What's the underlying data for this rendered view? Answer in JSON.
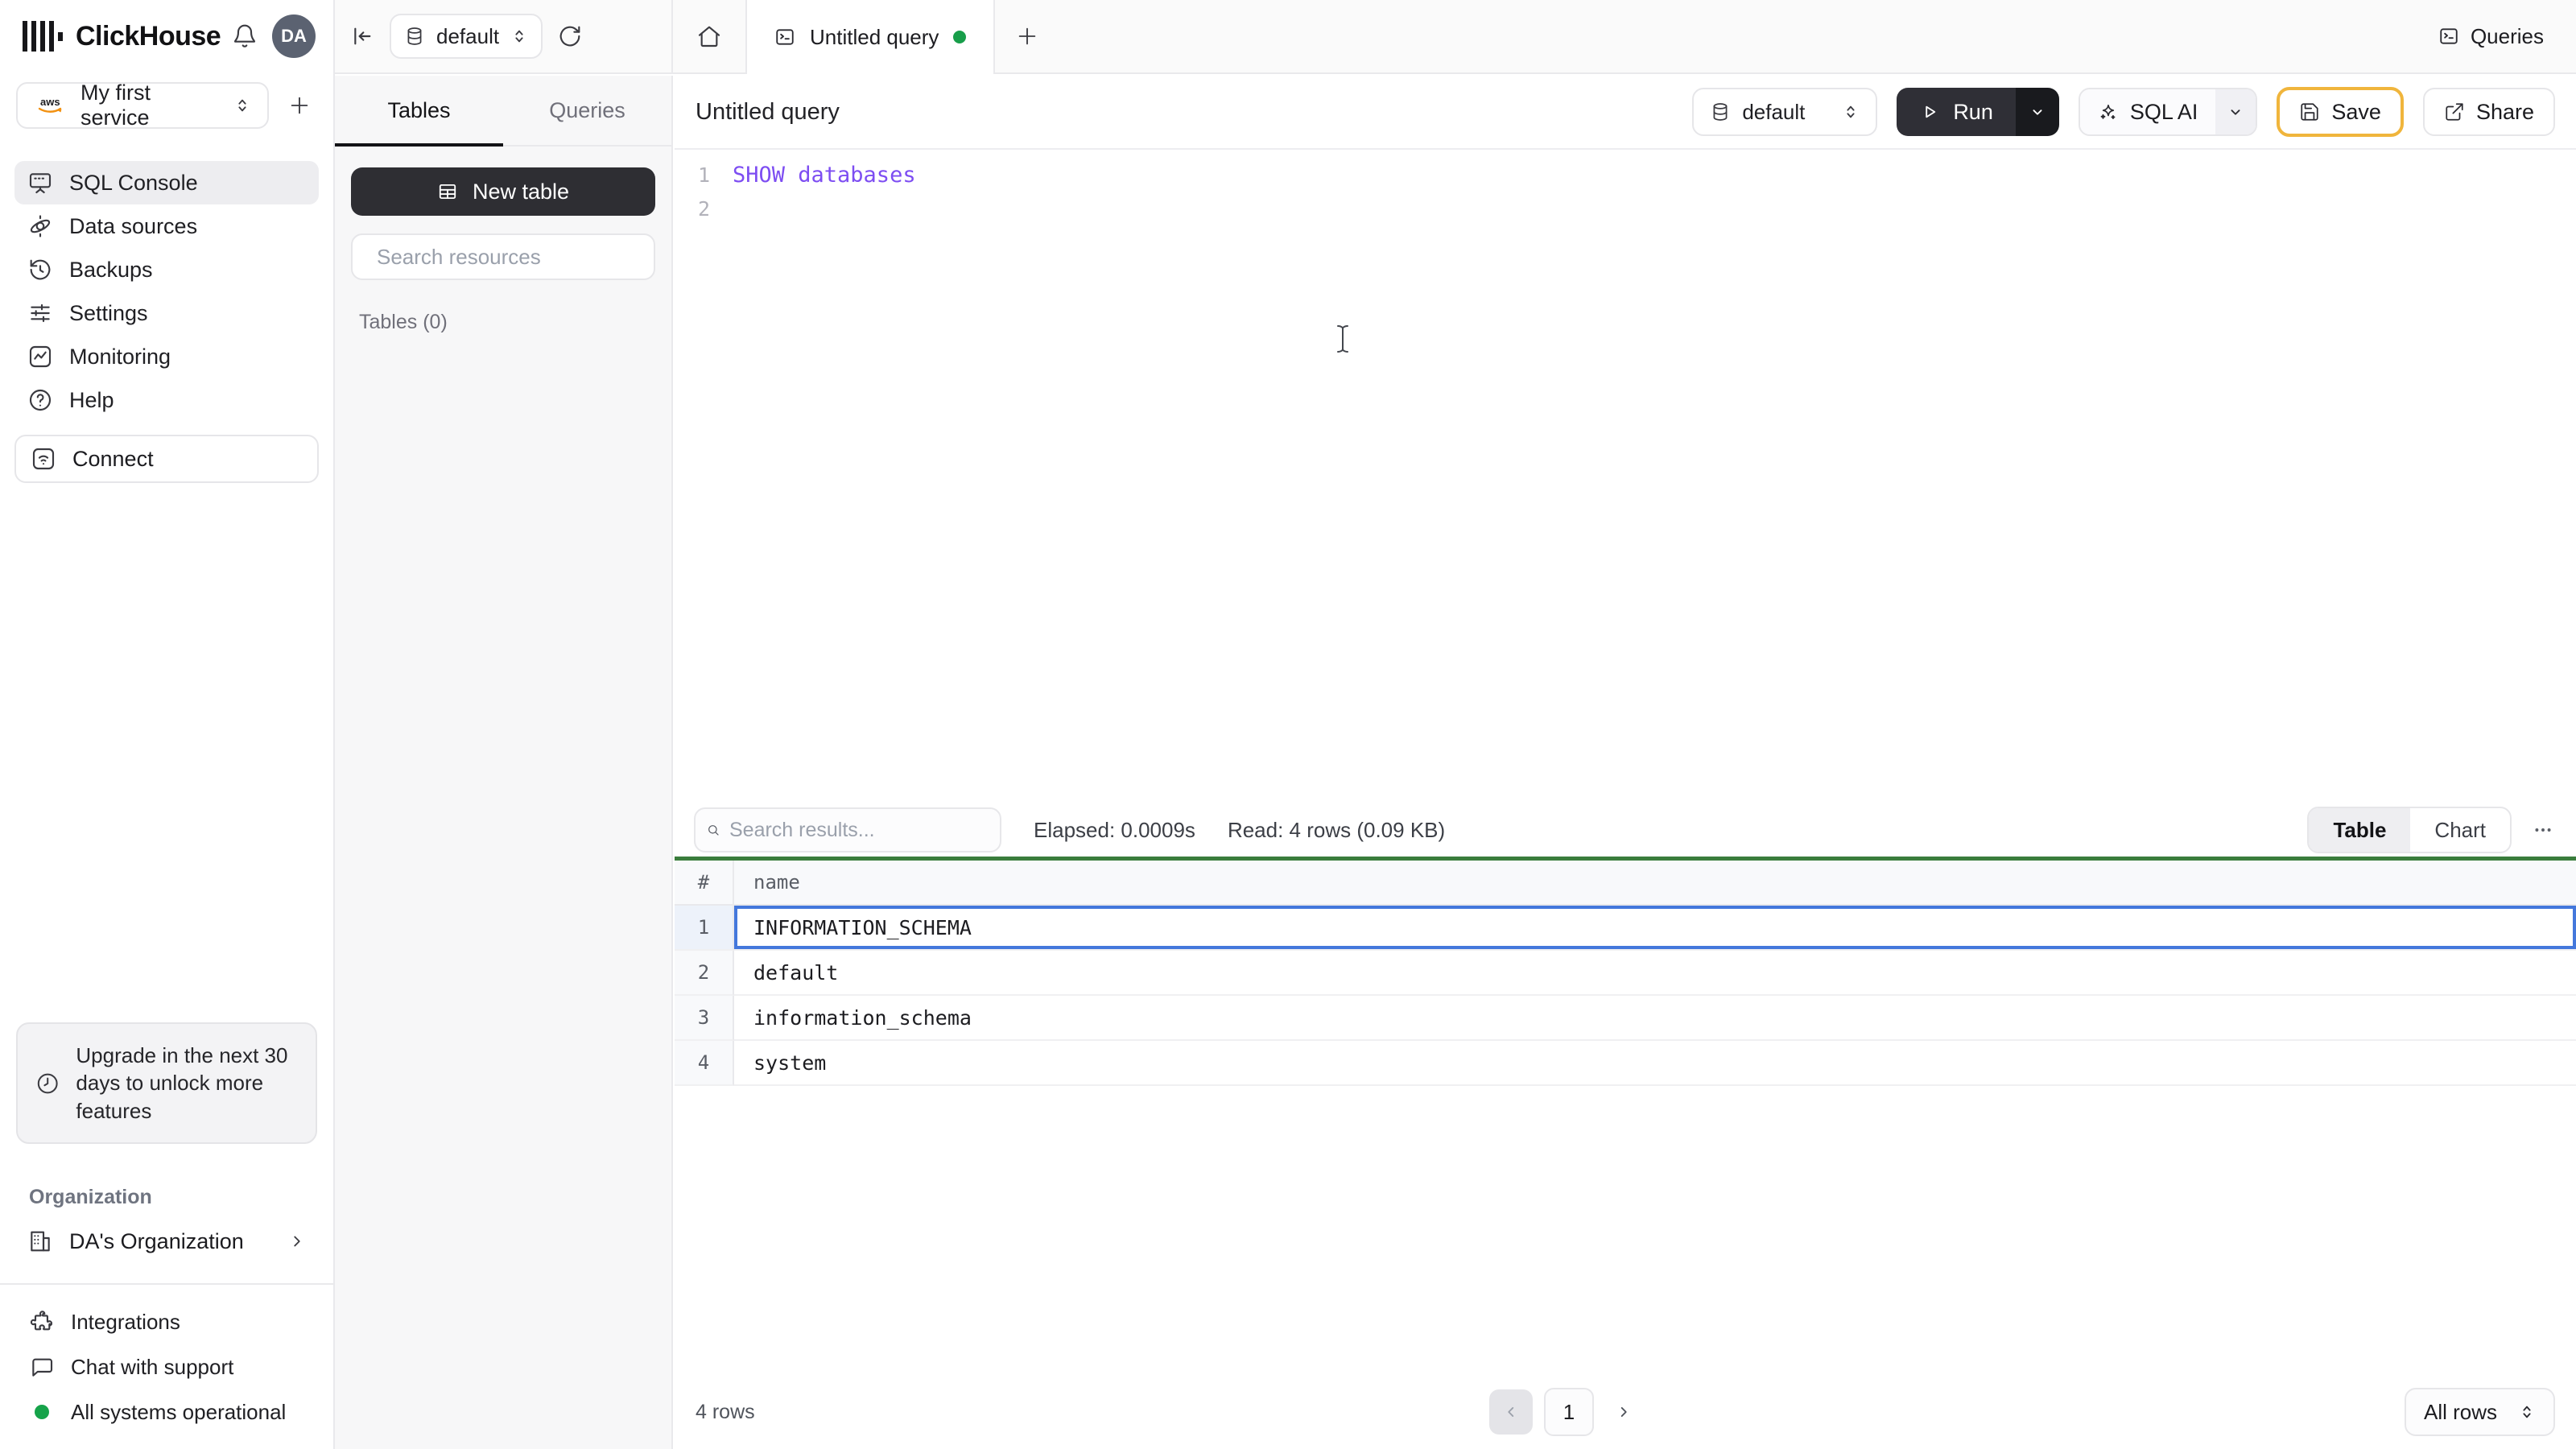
{
  "app": {
    "name": "ClickHouse",
    "avatar_initials": "DA"
  },
  "sidebar": {
    "service": {
      "provider_label": "aws",
      "label": "My first service"
    },
    "items": [
      {
        "label": "SQL Console",
        "active": true
      },
      {
        "label": "Data sources",
        "active": false
      },
      {
        "label": "Backups",
        "active": false
      },
      {
        "label": "Settings",
        "active": false
      },
      {
        "label": "Monitoring",
        "active": false
      },
      {
        "label": "Help",
        "active": false
      }
    ],
    "connect_label": "Connect",
    "upgrade_notice": "Upgrade in the next 30 days to unlock more features",
    "organization": {
      "section_label": "Organization",
      "name": "DA's Organization"
    },
    "footer_items": {
      "integrations": "Integrations",
      "chat": "Chat with support",
      "status": "All systems operational"
    }
  },
  "tabbar": {
    "database": "default",
    "active_tab": "Untitled query",
    "queries_label": "Queries"
  },
  "toolbar": {
    "title": "Untitled query",
    "database": "default",
    "run_label": "Run",
    "sql_ai_label": "SQL AI",
    "save_label": "Save",
    "share_label": "Share"
  },
  "explorer": {
    "tabs": {
      "tables": "Tables",
      "queries": "Queries"
    },
    "new_table_label": "New table",
    "search_placeholder": "Search resources",
    "tables_count": "Tables (0)"
  },
  "editor": {
    "lines": [
      {
        "num": "1",
        "code": "SHOW databases"
      },
      {
        "num": "2",
        "code": ""
      }
    ]
  },
  "results": {
    "search_placeholder": "Search results...",
    "elapsed": "Elapsed: 0.0009s",
    "read": "Read: 4 rows (0.09 KB)",
    "view_tabs": {
      "table": "Table",
      "chart": "Chart"
    },
    "table": {
      "columns": {
        "index": "#",
        "name": "name"
      },
      "rows": [
        {
          "num": "1",
          "name": "INFORMATION_SCHEMA",
          "selected": true
        },
        {
          "num": "2",
          "name": "default",
          "selected": false
        },
        {
          "num": "3",
          "name": "information_schema",
          "selected": false
        },
        {
          "num": "4",
          "name": "system",
          "selected": false
        }
      ]
    },
    "footer": {
      "row_count": "4 rows",
      "page": "1",
      "page_size": "All rows"
    }
  },
  "colors": {
    "accent_green_bar": "#3a7d3c",
    "status_green": "#16a34a",
    "tab_dot_green": "#189e4a",
    "selection_blue": "#4478dc",
    "save_border_yellow": "#f0b53c",
    "code_keyword_purple": "#7d4df2",
    "dark_button": "#2e2e33"
  }
}
